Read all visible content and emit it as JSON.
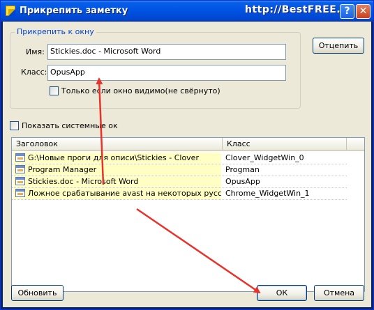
{
  "window": {
    "title": "Прикрепить заметку",
    "watermark": "http://BestFREE.ru",
    "help_glyph": "?",
    "close_glyph": "✕"
  },
  "group": {
    "legend": "Прикрепить к окну",
    "name_label": "Имя:",
    "name_value": "Stickies.doc - Microsoft Word",
    "class_label": "Класс:",
    "class_value": "OpusApp",
    "visible_only_label": "Только если окно видимо(не свёрнуто)",
    "detach_button": "Отцепить"
  },
  "show_system_label": "Показать системные ок",
  "table": {
    "columns": [
      "Заголовок",
      "Класс"
    ],
    "rows": [
      {
        "title": "G:\\Новые проги для описи\\Stickies - Clover",
        "class": "Clover_WidgetWin_0"
      },
      {
        "title": "Program Manager",
        "class": "Progman"
      },
      {
        "title": "Stickies.doc - Microsoft Word",
        "class": "OpusApp"
      },
      {
        "title": "Ложное срабатывание avast на некоторых русских...",
        "class": "Chrome_WidgetWin_1"
      }
    ]
  },
  "buttons": {
    "refresh": "Обновить",
    "ok": "ОК",
    "cancel": "Отмена"
  },
  "colors": {
    "titlebar": "#0055e5",
    "client": "#ece9d8",
    "row_highlight": "#ffffc4",
    "annotation_arrow": "#e8322a"
  }
}
